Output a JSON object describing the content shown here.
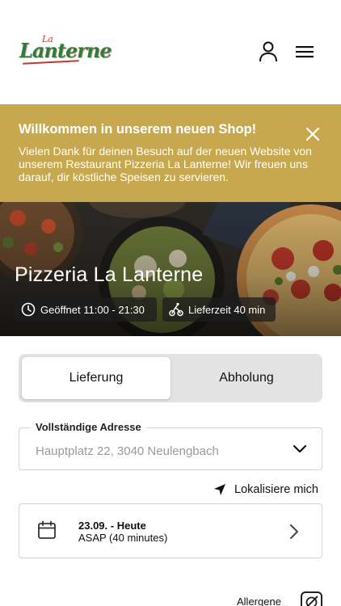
{
  "header": {
    "logo_small": "La",
    "logo_text": "Lanterne"
  },
  "banner": {
    "title": "Willkommen in unserem neuen Shop!",
    "text": "Vielen Dank für deinen Besuch auf der neuen Website von unserem Restaurant Pizzeria La Lanterne! Wir freuen uns darauf, dir köstliche Speisen zu servieren.",
    "background": "#c8a84e"
  },
  "hero": {
    "title": "Pizzeria La Lanterne",
    "opening_hours": "Geöffnet 11:00 - 21:30",
    "delivery_time": "Lieferzeit 40 min"
  },
  "order_mode": {
    "delivery_label": "Lieferung",
    "pickup_label": "Abholung",
    "selected": "Lieferung"
  },
  "address": {
    "label": "Vollständige Adresse",
    "placeholder": "Hauptplatz 22, 3040 Neulengbach"
  },
  "locate_label": "Lokalisiere mich",
  "schedule": {
    "date": "23.09. - Heute",
    "time": "ASAP (40 minutes)"
  },
  "allergens_label": "Allergene"
}
